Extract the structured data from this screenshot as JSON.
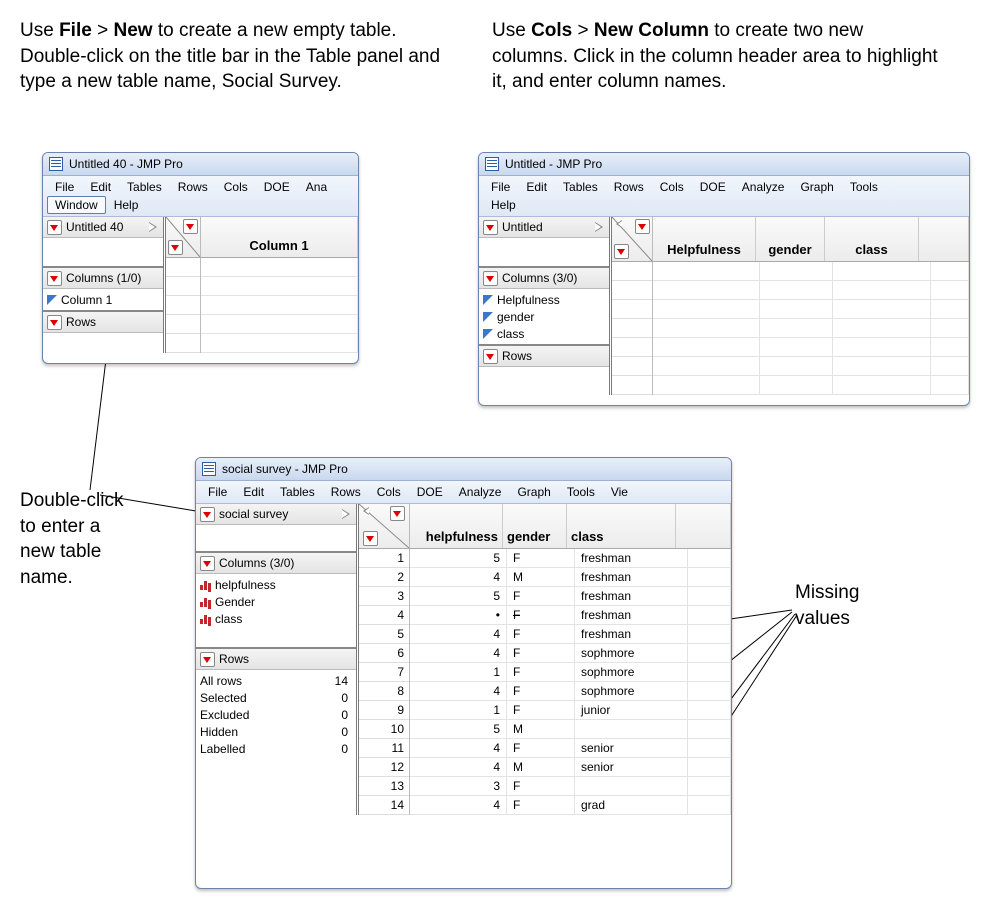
{
  "annotations": {
    "top_left": {
      "pre1": "Use ",
      "b1": "File",
      "mid1": " > ",
      "b2": "New",
      "rest": " to create a new empty table. Double-click on the title bar in the Table panel and type a new table name, Social Survey."
    },
    "top_right": {
      "pre1": "Use ",
      "b1": "Cols",
      "mid1": " > ",
      "b2": "New Column",
      "rest": " to create two new columns. Click in the column header area to highlight it, and enter column names."
    },
    "left_caption": "Double-click\nto enter a\nnew table\nname.",
    "right_caption": "Missing\nvalues"
  },
  "win1": {
    "title": "Untitled 40 - JMP Pro",
    "menus": [
      "File",
      "Edit",
      "Tables",
      "Rows",
      "Cols",
      "DOE",
      "Ana"
    ],
    "menus2": [
      "Window",
      "Help"
    ],
    "table_name": "Untitled 40",
    "columns_head": "Columns (1/0)",
    "columns": [
      "Column 1"
    ],
    "rows_head": "Rows",
    "grid_header": "Column 1"
  },
  "win2": {
    "title": "Untitled - JMP Pro",
    "menus": [
      "File",
      "Edit",
      "Tables",
      "Rows",
      "Cols",
      "DOE",
      "Analyze",
      "Graph",
      "Tools"
    ],
    "menus2": [
      "Help"
    ],
    "table_name": "Untitled",
    "columns_head": "Columns (3/0)",
    "columns": [
      "Helpfulness",
      "gender",
      "class"
    ],
    "rows_head": "Rows",
    "grid_headers": [
      "Helpfulness",
      "gender",
      "class"
    ]
  },
  "win3": {
    "title": "social survey - JMP Pro",
    "menus": [
      "File",
      "Edit",
      "Tables",
      "Rows",
      "Cols",
      "DOE",
      "Analyze",
      "Graph",
      "Tools",
      "Vie"
    ],
    "table_name": "social survey",
    "columns_head": "Columns (3/0)",
    "columns": [
      "helpfulness",
      "Gender",
      "class"
    ],
    "rows_head": "Rows",
    "row_stats": {
      "All rows": "14",
      "Selected": "0",
      "Excluded": "0",
      "Hidden": "0",
      "Labelled": "0"
    },
    "grid_headers": [
      "helpfulness",
      "gender",
      "class"
    ],
    "data": [
      {
        "n": 1,
        "help": "5",
        "gender": "F",
        "class": "freshman"
      },
      {
        "n": 2,
        "help": "4",
        "gender": "M",
        "class": "freshman"
      },
      {
        "n": 3,
        "help": "5",
        "gender": "F",
        "class": "freshman"
      },
      {
        "n": 4,
        "help": "•",
        "gender": "F",
        "gender_strike": true,
        "class": "freshman"
      },
      {
        "n": 5,
        "help": "4",
        "gender": "F",
        "class": "freshman"
      },
      {
        "n": 6,
        "help": "4",
        "gender": "F",
        "class": "sophmore"
      },
      {
        "n": 7,
        "help": "1",
        "gender": "F",
        "class": "sophmore"
      },
      {
        "n": 8,
        "help": "4",
        "gender": "F",
        "class": "sophmore"
      },
      {
        "n": 9,
        "help": "1",
        "gender": "F",
        "class": "junior"
      },
      {
        "n": 10,
        "help": "5",
        "gender": "M",
        "class": ""
      },
      {
        "n": 11,
        "help": "4",
        "gender": "F",
        "class": "senior"
      },
      {
        "n": 12,
        "help": "4",
        "gender": "M",
        "class": "senior"
      },
      {
        "n": 13,
        "help": "3",
        "gender": "F",
        "class": ""
      },
      {
        "n": 14,
        "help": "4",
        "gender": "F",
        "class": "grad"
      }
    ]
  }
}
